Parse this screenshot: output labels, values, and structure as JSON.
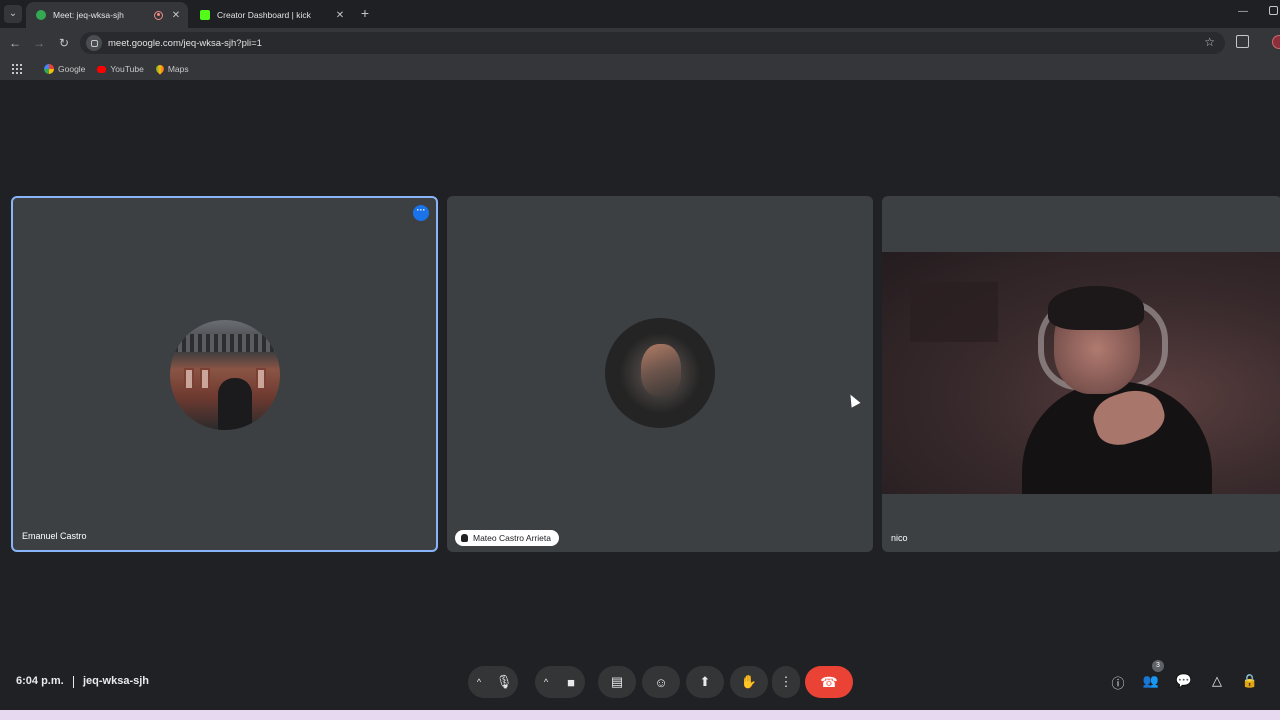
{
  "browser": {
    "tabs": [
      {
        "title": "Meet: jeq-wksa-sjh",
        "favicon_color": "#34a853",
        "recording": true
      },
      {
        "title": "Creator Dashboard | kick",
        "favicon_color": "#53fc18",
        "recording": false
      }
    ],
    "url": "meet.google.com/jeq-wksa-sjh?pli=1",
    "bookmarks": [
      {
        "label": "Google",
        "icon": "google-icon",
        "color": "#4285f4"
      },
      {
        "label": "YouTube",
        "icon": "youtube-icon",
        "color": "#ff0000"
      },
      {
        "label": "Maps",
        "icon": "maps-icon",
        "color": "#34a853"
      }
    ]
  },
  "meet": {
    "participants": [
      {
        "name": "Emanuel Castro",
        "active_speaker": true,
        "video": false
      },
      {
        "name": "Mateo Castro Arrieta",
        "active_speaker": false,
        "video": false
      },
      {
        "name": "nico",
        "active_speaker": false,
        "video": true
      }
    ],
    "time": "6:04 p.m.",
    "meeting_code": "jeq-wksa-sjh",
    "people_count": "3",
    "colors": {
      "accent": "#8ab4f8",
      "end_call": "#ea4335",
      "tile": "#3c4043",
      "background": "#202124"
    }
  }
}
